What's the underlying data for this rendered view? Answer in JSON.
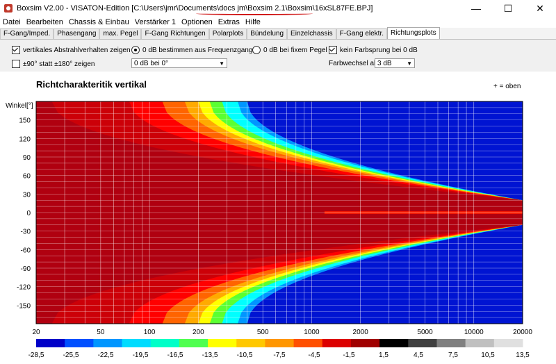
{
  "window": {
    "title": "Boxsim V2.00 - VISATON-Edition [C:\\Users\\jmr\\Documents\\docs jm\\Boxsim 2.1\\Boxsim\\16xSL87FE.BPJ]",
    "minimize": "—",
    "maximize": "☐",
    "close": "✕"
  },
  "menu": [
    "Datei",
    "Bearbeiten",
    "Chassis & Einbau",
    "Verstärker 1",
    "Optionen",
    "Extras",
    "Hilfe"
  ],
  "tabs": [
    {
      "label": "F-Gang/Imped.",
      "active": false
    },
    {
      "label": "Phasengang",
      "active": false
    },
    {
      "label": "max. Pegel",
      "active": false
    },
    {
      "label": "F-Gang Richtungen",
      "active": false
    },
    {
      "label": "Polarplots",
      "active": false
    },
    {
      "label": "Bündelung",
      "active": false
    },
    {
      "label": "Einzelchassis",
      "active": false
    },
    {
      "label": "F-Gang elektr.",
      "active": false
    },
    {
      "label": "Richtungsplots",
      "active": true
    }
  ],
  "options": {
    "vertical_label": "vertikales Abstrahlverhalten zeigen",
    "vertical_checked": true,
    "pm90_label": "±90° statt ±180° zeigen",
    "pm90_checked": false,
    "radio_freq_label": "0 dB bestimmen aus Frequenzgang",
    "radio_fixed_label": "0 dB bei fixem Pegel",
    "zero_db_select": "0 dB bei 0°",
    "kein_farbsprung_label": "kein Farbsprung bei 0 dB",
    "kein_farbsprung_checked": true,
    "farbwechsel_label": "Farbwechsel  alle",
    "farbwechsel_select": "3 dB"
  },
  "chart_data": {
    "type": "heatmap",
    "title": "Richtcharakteritik vertikal",
    "note": "+ = oben",
    "ylabel": "Winkel[°]",
    "x_ticks": [
      "20",
      "50",
      "100",
      "200",
      "500",
      "1000",
      "2000",
      "5000",
      "10000",
      "20000"
    ],
    "x_tick_values": [
      20,
      50,
      100,
      200,
      500,
      1000,
      2000,
      5000,
      10000,
      20000
    ],
    "xlim": [
      20,
      20000
    ],
    "x_scale": "log",
    "y_ticks": [
      "150",
      "120",
      "90",
      "60",
      "30",
      "0",
      "-30",
      "-60",
      "-90",
      "-120",
      "-150"
    ],
    "y_tick_values": [
      150,
      120,
      90,
      60,
      30,
      0,
      -30,
      -60,
      -90,
      -120,
      -150
    ],
    "ylim": [
      -180,
      180
    ],
    "grid": true,
    "colorbar_labels": [
      "-28,5",
      "-25,5",
      "-22,5",
      "-19,5",
      "-16,5",
      "-13,5",
      "-10,5",
      "-7,5",
      "-4,5",
      "-1,5",
      "1,5",
      "4,5",
      "7,5",
      "10,5",
      "13,5"
    ],
    "colorbar_colors": [
      "#0000c8",
      "#0050ff",
      "#0096ff",
      "#00dcff",
      "#00ffc8",
      "#50ff50",
      "#ffff00",
      "#ffc800",
      "#ff9600",
      "#ff5000",
      "#dc0000",
      "#a00000",
      "#000000",
      "#404040",
      "#808080",
      "#c0c0c0",
      "#e0e0e0"
    ],
    "band_colors": [
      "#b00010",
      "#cc0008",
      "#ff0000",
      "#ff6400",
      "#ffaa00",
      "#ffff00",
      "#5aff32",
      "#00ffff",
      "#0096ff",
      "#0014d2"
    ]
  }
}
